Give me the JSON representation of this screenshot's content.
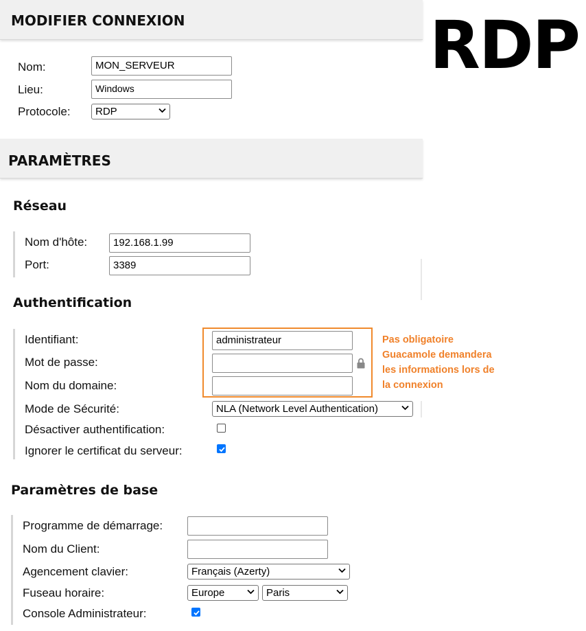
{
  "header": {
    "title": "MODIFIER CONNEXION"
  },
  "badge": {
    "text": "RDP"
  },
  "connection": {
    "name_label": "Nom:",
    "name_value": "MON_SERVEUR",
    "location_label": "Lieu:",
    "location_value": "Windows",
    "protocol_label": "Protocole:",
    "protocol_value": "RDP"
  },
  "parameters": {
    "title": "PARAMÈTRES"
  },
  "network": {
    "title": "Réseau",
    "host_label": "Nom d'hôte:",
    "host_value": "192.168.1.99",
    "port_label": "Port:",
    "port_value": "3389"
  },
  "auth": {
    "title": "Authentification",
    "user_label": "Identifiant:",
    "user_value": "administrateur",
    "password_label": "Mot de passe:",
    "password_value": "",
    "domain_label": "Nom du domaine:",
    "domain_value": "",
    "security_label": "Mode de Sécurité:",
    "security_value": "NLA (Network Level Authentication)",
    "disable_auth_label": "Désactiver authentification:",
    "disable_auth_checked": false,
    "ignore_cert_label": "Ignorer le certificat du serveur:",
    "ignore_cert_checked": true
  },
  "note": {
    "line1": "Pas obligatoire",
    "line2": "Guacamole demandera",
    "line3": "les informations lors de",
    "line4": "la connexion",
    "color": "#f0812a"
  },
  "basic": {
    "title": "Paramètres de base",
    "startup_label": "Programme de démarrage:",
    "startup_value": "",
    "client_label": "Nom du Client:",
    "client_value": "",
    "keyboard_label": "Agencement clavier:",
    "keyboard_value": "Français (Azerty)",
    "timezone_label": "Fuseau horaire:",
    "timezone_region": "Europe",
    "timezone_city": "Paris",
    "console_label": "Console Administrateur:",
    "console_checked": true
  }
}
